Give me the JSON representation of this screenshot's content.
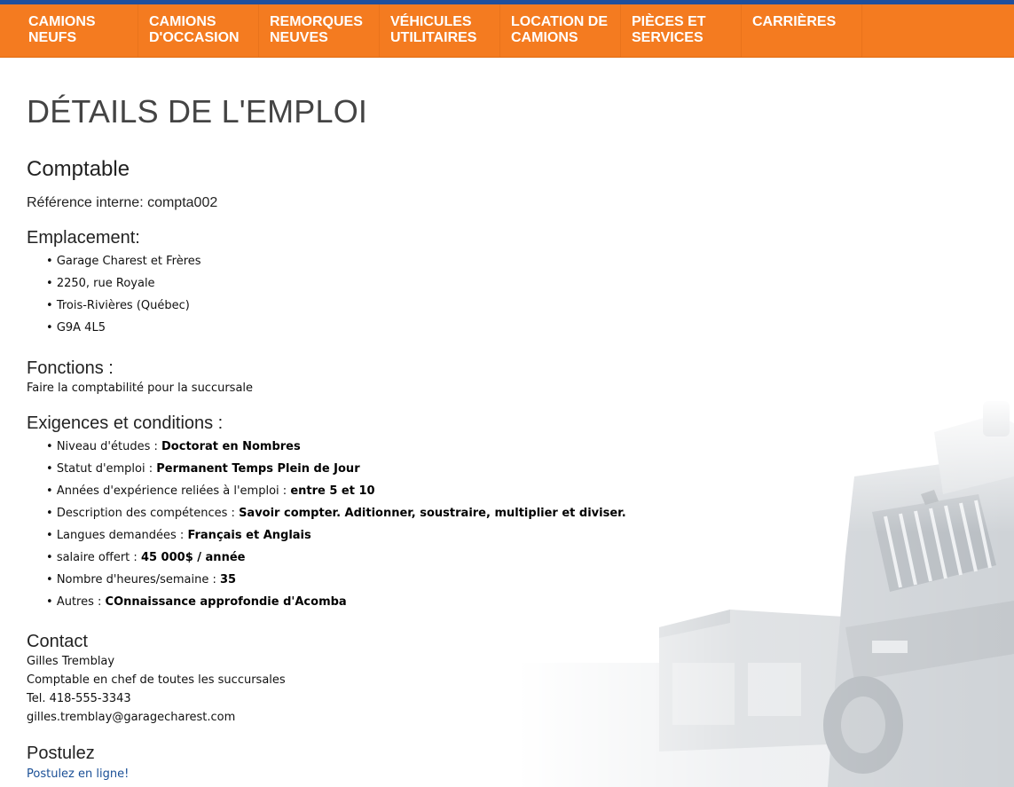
{
  "nav": {
    "items": [
      {
        "label": "CAMIONS\nNEUFS"
      },
      {
        "label": "CAMIONS\nD'OCCASION"
      },
      {
        "label": "REMORQUES\nNEUVES"
      },
      {
        "label": "VÉHICULES\nUTILITAIRES"
      },
      {
        "label": "LOCATION DE\nCAMIONS"
      },
      {
        "label": "PIÈCES ET\nSERVICES"
      },
      {
        "label": "CARRIÈRES"
      }
    ]
  },
  "page": {
    "title": "DÉTAILS DE L'EMPLOI",
    "job_title": "Comptable",
    "reference": "Référence interne: compta002"
  },
  "location": {
    "heading": "Emplacement:",
    "lines": [
      "Garage Charest et Frères",
      "2250, rue Royale",
      "Trois-Rivières (Québec)",
      "G9A 4L5"
    ]
  },
  "functions": {
    "heading": "Fonctions :",
    "text": "Faire la comptabilité pour la succursale"
  },
  "requirements": {
    "heading": "Exigences et conditions :",
    "items": [
      {
        "label": "Niveau d'études : ",
        "value": "Doctorat en Nombres"
      },
      {
        "label": "Statut d'emploi : ",
        "value": "Permanent Temps Plein de Jour"
      },
      {
        "label": "Années d'expérience reliées à l'emploi : ",
        "value": "entre 5 et 10"
      },
      {
        "label": "Description des compétences : ",
        "value": "Savoir compter. Aditionner, soustraire, multiplier et diviser."
      },
      {
        "label": "Langues demandées : ",
        "value": "Français et Anglais"
      },
      {
        "label": "salaire offert : ",
        "value": "45 000$ / année"
      },
      {
        "label": "Nombre d'heures/semaine : ",
        "value": "35"
      },
      {
        "label": "Autres : ",
        "value": "COnnaissance approfondie d'Acomba"
      }
    ]
  },
  "contact": {
    "heading": "Contact",
    "name": "Gilles Tremblay",
    "role": "Comptable en chef de toutes les succursales",
    "phone": "Tel. 418-555-3343",
    "email": "gilles.tremblay@garagecharest.com"
  },
  "apply": {
    "heading": "Postulez",
    "link_label": "Postulez en ligne!"
  },
  "colors": {
    "nav_bg": "#f47b20",
    "top_stripe": "#1f4f9c",
    "link": "#1a4f96"
  }
}
